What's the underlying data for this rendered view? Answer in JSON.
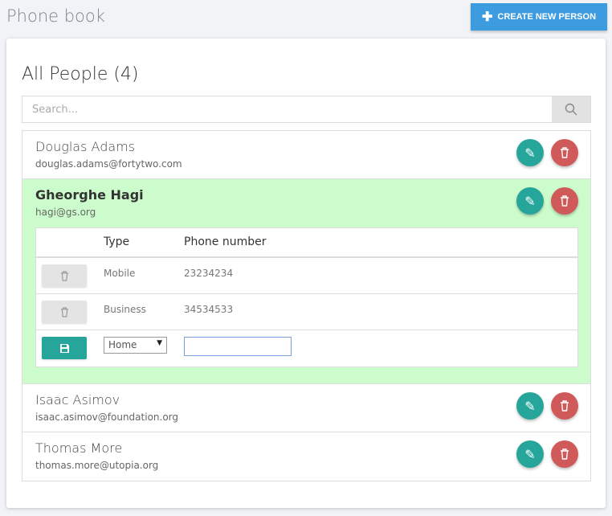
{
  "app": {
    "title": "Phone book",
    "create_label": "CREATE NEW PERSON"
  },
  "main": {
    "heading": "All People (4)",
    "search_placeholder": "Search..."
  },
  "people": [
    {
      "name": "Douglas Adams",
      "email": "douglas.adams@fortytwo.com"
    },
    {
      "name": "Gheorghe Hagi",
      "email": "hagi@gs.org",
      "expanded": true
    },
    {
      "name": "Isaac Asimov",
      "email": "isaac.asimov@foundation.org"
    },
    {
      "name": "Thomas More",
      "email": "thomas.more@utopia.org"
    }
  ],
  "phones": {
    "headers": {
      "type": "Type",
      "number": "Phone number"
    },
    "rows": [
      {
        "type": "Mobile",
        "number": "23234234"
      },
      {
        "type": "Business",
        "number": "34534533"
      }
    ],
    "new_row": {
      "type": "Home",
      "number": ""
    }
  },
  "colors": {
    "accent": "#3d9be0",
    "edit": "#26a69a",
    "delete": "#d05a5a",
    "selected_bg": "#ccfccb"
  }
}
